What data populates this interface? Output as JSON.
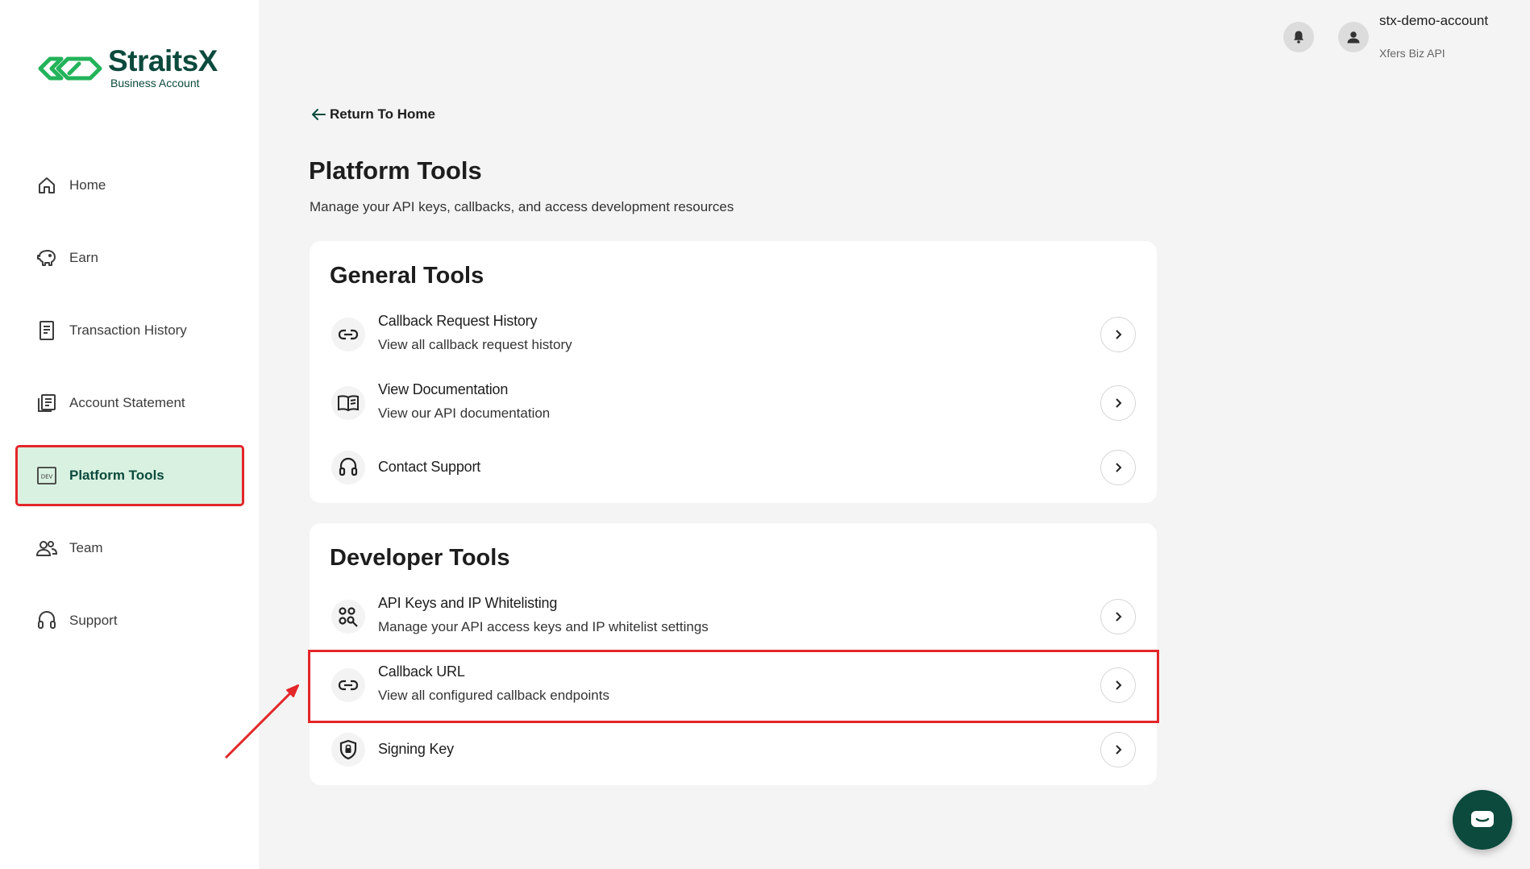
{
  "brand": {
    "name": "StraitsX",
    "subtitle": "Business Account",
    "color": "#0b4a3c",
    "accent": "#23b35a"
  },
  "sidebar": {
    "items": [
      {
        "label": "Home",
        "icon": "home-icon"
      },
      {
        "label": "Earn",
        "icon": "piggy-bank-icon"
      },
      {
        "label": "Transaction History",
        "icon": "receipt-icon"
      },
      {
        "label": "Account Statement",
        "icon": "document-icon"
      },
      {
        "label": "Platform Tools",
        "icon": "dev-icon",
        "active": true
      },
      {
        "label": "Team",
        "icon": "team-icon"
      },
      {
        "label": "Support",
        "icon": "headset-icon"
      }
    ]
  },
  "header": {
    "account_name": "stx-demo-account",
    "account_sub": "Xfers Biz API"
  },
  "main": {
    "back_label": "Return To Home",
    "title": "Platform Tools",
    "description": "Manage your API keys, callbacks, and access development resources",
    "general": {
      "title": "General Tools",
      "items": [
        {
          "title": "Callback Request History",
          "subtitle": "View all callback request history",
          "icon": "link-icon"
        },
        {
          "title": "View Documentation",
          "subtitle": "View our API documentation",
          "icon": "book-icon"
        },
        {
          "title": "Contact Support",
          "subtitle": "",
          "icon": "headset-icon"
        }
      ]
    },
    "developer": {
      "title": "Developer Tools",
      "items": [
        {
          "title": "API Keys and IP Whitelisting",
          "subtitle": "Manage your API access keys and IP whitelist settings",
          "icon": "key-search-icon"
        },
        {
          "title": "Callback URL",
          "subtitle": "View all configured callback endpoints",
          "icon": "link-icon",
          "highlighted": true
        },
        {
          "title": "Signing Key",
          "subtitle": "",
          "icon": "shield-lock-icon"
        }
      ]
    }
  },
  "annotation_color": "#e3262a"
}
